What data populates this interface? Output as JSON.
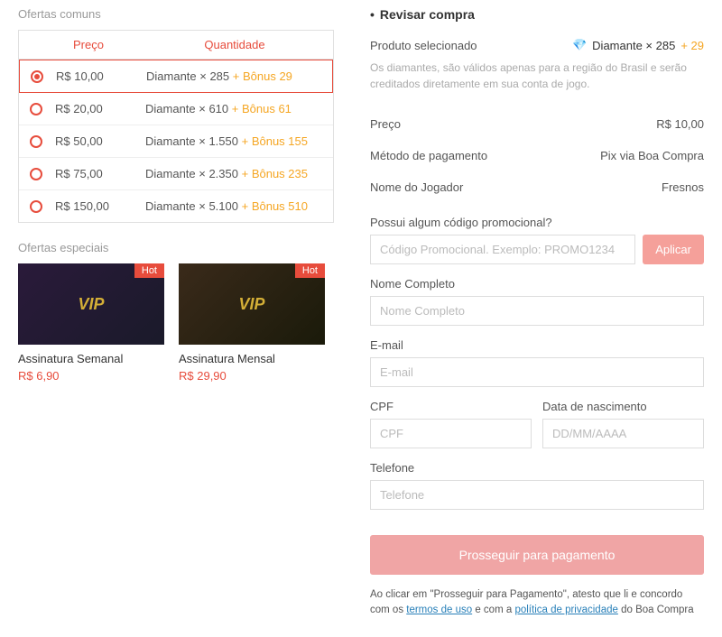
{
  "left": {
    "common_title": "Ofertas comuns",
    "header_price": "Preço",
    "header_qty": "Quantidade",
    "offers": [
      {
        "price": "R$ 10,00",
        "qty": "Diamante × 285",
        "bonus": "+ Bônus 29",
        "selected": true
      },
      {
        "price": "R$ 20,00",
        "qty": "Diamante × 610",
        "bonus": "+ Bônus 61",
        "selected": false
      },
      {
        "price": "R$ 50,00",
        "qty": "Diamante × 1.550",
        "bonus": "+ Bônus 155",
        "selected": false
      },
      {
        "price": "R$ 75,00",
        "qty": "Diamante × 2.350",
        "bonus": "+ Bônus 235",
        "selected": false
      },
      {
        "price": "R$ 150,00",
        "qty": "Diamante × 5.100",
        "bonus": "+ Bônus 510",
        "selected": false
      }
    ],
    "special_title": "Ofertas especiais",
    "hot": "Hot",
    "specials": [
      {
        "title": "Assinatura Semanal",
        "price": "R$ 6,90"
      },
      {
        "title": "Assinatura Mensal",
        "price": "R$ 29,90"
      }
    ]
  },
  "right": {
    "title": "Revisar compra",
    "product_label": "Produto selecionado",
    "product_base": "Diamante × 285",
    "product_bonus": "+ 29",
    "note": "Os diamantes, são válidos apenas para a região do Brasil e serão creditados diretamente em sua conta de jogo.",
    "rows": {
      "price_label": "Preço",
      "price_value": "R$ 10,00",
      "method_label": "Método de pagamento",
      "method_value": "Pix via Boa Compra",
      "player_label": "Nome do Jogador",
      "player_value": "Fresnos"
    },
    "promo_label": "Possui algum código promocional?",
    "promo_placeholder": "Código Promocional. Exemplo: PROMO1234",
    "apply": "Aplicar",
    "fullname_label": "Nome Completo",
    "fullname_placeholder": "Nome Completo",
    "email_label": "E-mail",
    "email_placeholder": "E-mail",
    "cpf_label": "CPF",
    "cpf_placeholder": "CPF",
    "dob_label": "Data de nascimento",
    "dob_placeholder": "DD/MM/AAAA",
    "phone_label": "Telefone",
    "phone_placeholder": "Telefone",
    "proceed": "Prosseguir para pagamento",
    "disclaimer_pre": "Ao clicar em \"Prosseguir para Pagamento\", atesto que li e concordo com os ",
    "terms": "termos de uso",
    "disclaimer_mid": " e com a ",
    "privacy": "política de privacidade",
    "disclaimer_post": " do Boa Compra"
  }
}
